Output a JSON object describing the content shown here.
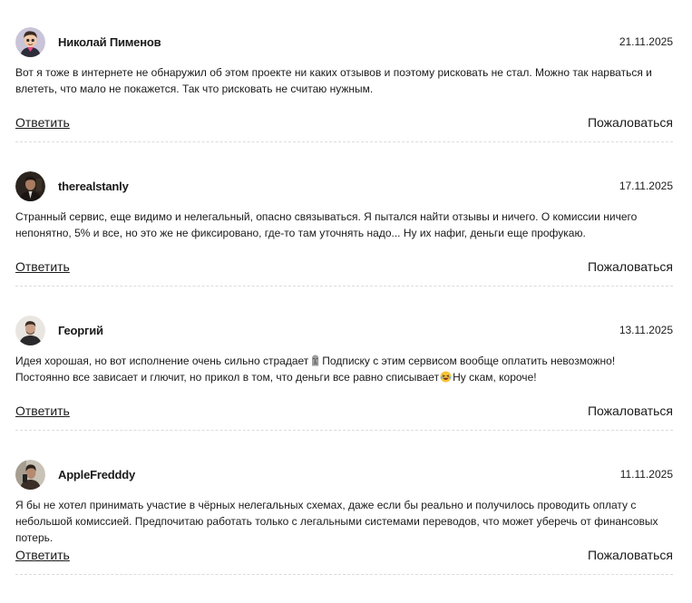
{
  "comments": [
    {
      "author": "Николай Пименов",
      "date": "21.11.2025",
      "avatar_icon": "cartoon-person-avatar",
      "text_parts": [
        "Вот я тоже в интернете не обнаружил об этом проекте ни каких отзывов и поэтому рисковать не стал. Можно так нарваться и влететь, что мало не покажется. Так что рисковать не считаю нужным."
      ],
      "reply_label": "Ответить",
      "report_label": "Пожаловаться"
    },
    {
      "author": "therealstanly",
      "date": "17.11.2025",
      "avatar_icon": "man-in-suit-photo-avatar",
      "text_parts": [
        "Странный сервис, еще видимо и нелегальный, опасно связываться. Я пытался найти отзывы и ничего. О комиссии ничего непонятно, 5% и все, но это же не фиксировано, где-то там уточнять надо... Ну их нафиг, деньги еще профукаю."
      ],
      "reply_label": "Ответить",
      "report_label": "Пожаловаться"
    },
    {
      "author": "Георгий",
      "date": "13.11.2025",
      "avatar_icon": "man-photo-avatar",
      "text_parts": [
        "Идея хорошая, но вот исполнение очень сильно страдает",
        "Подписку с этим сервисом вообще оплатить невозможно! Постоянно все зависает и глючит, но прикол в том, что деньги все равно списывает",
        "Ну скам, короче!"
      ],
      "emoji_icons": [
        "moai-emoji-icon",
        "laughing-emoji-icon"
      ],
      "reply_label": "Ответить",
      "report_label": "Пожаловаться"
    },
    {
      "author": "AppleFredddy",
      "date": "11.11.2025",
      "avatar_icon": "person-photo-avatar",
      "text_parts": [
        "Я бы не хотел принимать участие в чёрных нелегальных схемах, даже если бы реально и получилось проводить оплату с небольшой комиссией. Предпочитаю работать только с легальными системами переводов, что может уберечь от финансовых потерь."
      ],
      "reply_label": "Ответить",
      "report_label": "Пожаловаться"
    }
  ],
  "colors": {
    "text": "#1a1a1a",
    "divider": "#dcdcdc",
    "background": "#ffffff"
  }
}
